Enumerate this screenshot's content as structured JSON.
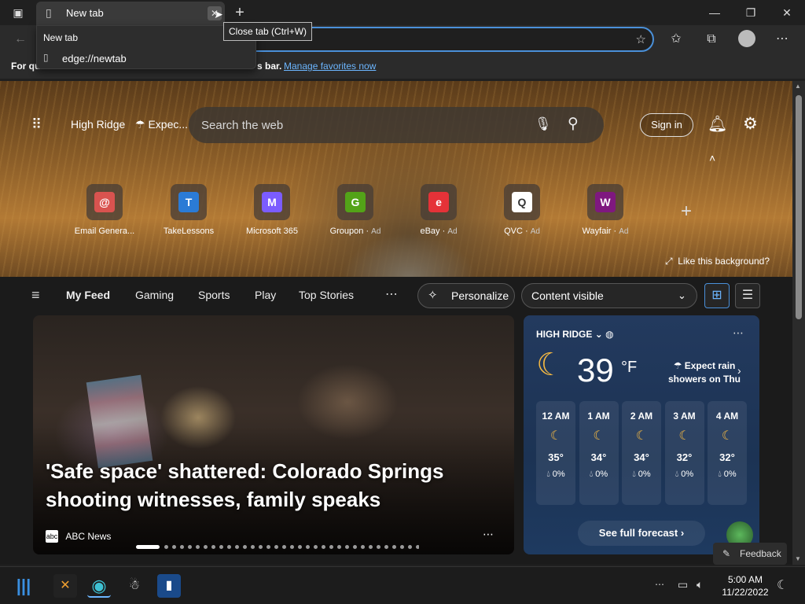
{
  "browser": {
    "tab_title": "New tab",
    "close_tab_tooltip": "Close tab (Ctrl+W)",
    "tab_dropdown": {
      "title": "New tab",
      "url": "edge://newtab"
    },
    "favorites_bar": {
      "text_start": "For qu",
      "text_end": "s bar.",
      "link": "Manage favorites now"
    }
  },
  "hero": {
    "location": "High Ridge",
    "weather_snippet": "Expec...",
    "search_placeholder": "Search the web",
    "sign_in": "Sign in",
    "like_background": "Like this background?",
    "quick_links": [
      {
        "label": "Email Genera...",
        "ad": "",
        "glyph": "@",
        "color": "#d9534f"
      },
      {
        "label": "TakeLessons",
        "ad": "",
        "glyph": "T",
        "color": "#2b7bd6"
      },
      {
        "label": "Microsoft 365",
        "ad": "",
        "glyph": "M",
        "color": "#7b5cff"
      },
      {
        "label": "Groupon",
        "ad": "Ad",
        "glyph": "G",
        "color": "#53a318"
      },
      {
        "label": "eBay",
        "ad": "Ad",
        "glyph": "e",
        "color": "#e53238"
      },
      {
        "label": "QVC",
        "ad": "Ad",
        "glyph": "Q",
        "color": "#ffffff"
      },
      {
        "label": "Wayfair",
        "ad": "Ad",
        "glyph": "W",
        "color": "#7f187f"
      }
    ]
  },
  "feed_nav": {
    "items": [
      "My Feed",
      "Gaming",
      "Sports",
      "Play",
      "Top Stories"
    ],
    "personalize": "Personalize",
    "content_visible": "Content visible"
  },
  "news": {
    "headline": "'Safe space' shattered: Colorado Springs shooting witnesses, family speaks",
    "source": "ABC News",
    "carousel_count": 35
  },
  "weather": {
    "location": "HIGH RIDGE",
    "temp": "39",
    "unit": "°F",
    "summary_line1": "Expect rain",
    "summary_line2": "showers on Thu",
    "hourly": [
      {
        "time": "12 AM",
        "temp": "35°",
        "precip": "0%"
      },
      {
        "time": "1 AM",
        "temp": "34°",
        "precip": "0%"
      },
      {
        "time": "2 AM",
        "temp": "34°",
        "precip": "0%"
      },
      {
        "time": "3 AM",
        "temp": "32°",
        "precip": "0%"
      },
      {
        "time": "4 AM",
        "temp": "32°",
        "precip": "0%"
      }
    ],
    "full_forecast": "See full forecast"
  },
  "feedback": "Feedback",
  "taskbar": {
    "time": "5:00 AM",
    "date": "11/22/2022"
  }
}
